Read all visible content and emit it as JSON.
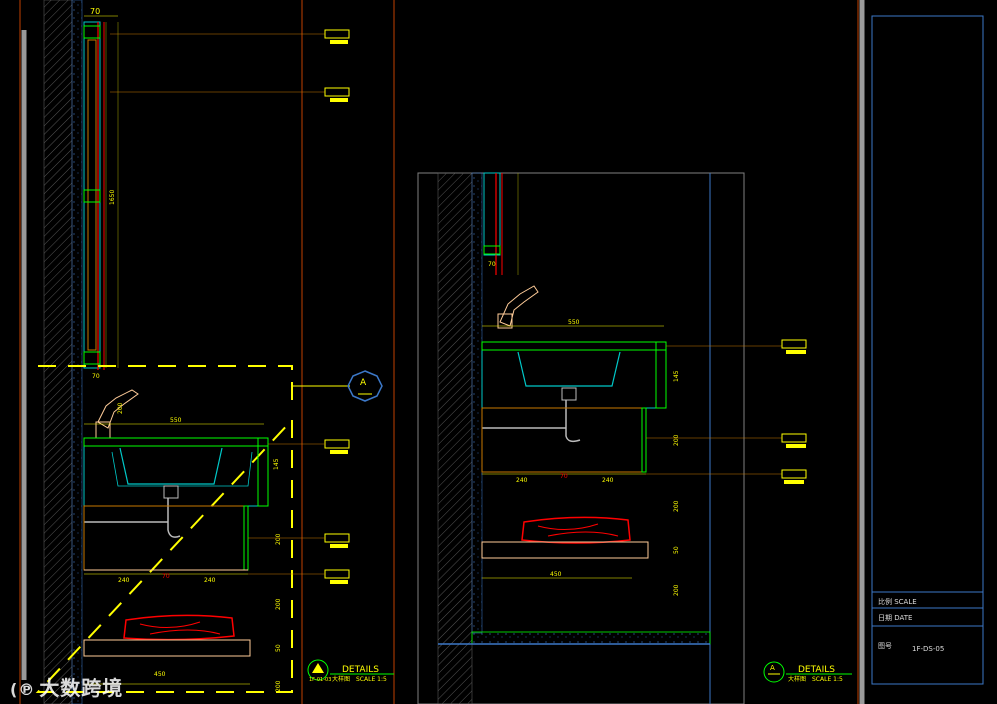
{
  "colors": {
    "background": "#000000",
    "yellow": "#ffff00",
    "red": "#ff0000",
    "cyan": "#00c8c8",
    "green": "#00ff00",
    "orange": "#c87800",
    "blue": "#1e50ff",
    "frame": "#c04000",
    "grey": "#808080",
    "border_blue": "#3c78c8"
  },
  "left_view": {
    "dims": {
      "top_width": "70",
      "bottom_width": "70",
      "vertical_height": "1650",
      "faucet_height": "200",
      "sink_width": "550",
      "sink_depth": "145",
      "cabinet_height": "200",
      "half_left": "240",
      "half_right": "240",
      "center_mark": "70",
      "shelf_gap": "200",
      "shelf_thickness": "50",
      "shelf_width": "450",
      "bottom_gap": "200"
    },
    "callout": {
      "letter": "A"
    },
    "details": {
      "title": "DETAILS",
      "code": "1F-01-03",
      "subtitle": "大样图",
      "scale": "SCALE 1:5"
    }
  },
  "right_view": {
    "dims": {
      "top_width": "70",
      "sink_width": "550",
      "sink_depth": "145",
      "cabinet_height": "200",
      "half_left": "240",
      "half_right": "240",
      "center_mark": "70",
      "shelf_gap": "200",
      "shelf_thickness": "50",
      "shelf_width": "450",
      "bottom_gap": "200"
    },
    "details": {
      "letter": "A",
      "title": "DETAILS",
      "subtitle": "大样图",
      "scale": "SCALE 1:5"
    }
  },
  "title_block": {
    "scale_label": "比例 SCALE",
    "date_label": "日期 DATE",
    "drawing_no_label": "图号",
    "drawing_no": "1F-DS-05"
  },
  "watermark": {
    "text": "大数跨境"
  }
}
